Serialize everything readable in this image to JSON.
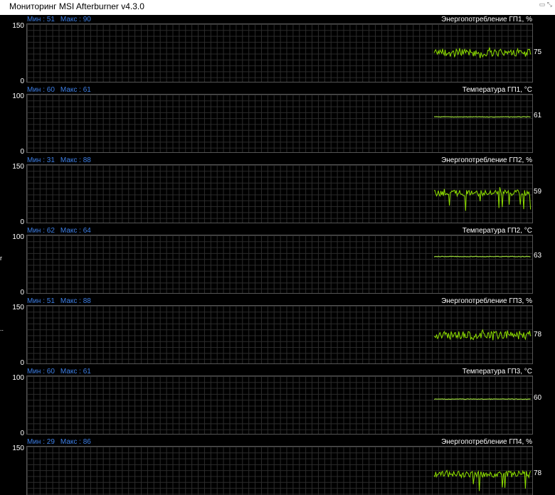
{
  "window": {
    "title": "Мониторинг MSI Afterburner v4.3.0",
    "icon": "window-controls-icon"
  },
  "panels": [
    {
      "min_label": "Мин : 51",
      "max_label": "Макс : 90",
      "title": "Энергопотребление ГП1, %",
      "ymax": "150",
      "ymin": "0",
      "current": "75",
      "value": 75,
      "vmax": 150,
      "trace": "noisy"
    },
    {
      "min_label": "Мин : 60",
      "max_label": "Макс : 61",
      "title": "Температура ГП1, °C",
      "ymax": "100",
      "ymin": "0",
      "current": "61",
      "value": 61,
      "vmax": 100,
      "trace": "flat"
    },
    {
      "min_label": "Мин : 31",
      "max_label": "Макс : 88",
      "title": "Энергопотребление ГП2, %",
      "ymax": "150",
      "ymin": "0",
      "current": "59",
      "value": 77,
      "vmax": 150,
      "trace": "spiky"
    },
    {
      "min_label": "Мин : 62",
      "max_label": "Макс : 64",
      "title": "Температура ГП2, °C",
      "ymax": "100",
      "ymin": "0",
      "current": "63",
      "value": 63,
      "vmax": 100,
      "trace": "flat"
    },
    {
      "min_label": "Мин : 51",
      "max_label": "Макс : 88",
      "title": "Энергопотребление ГП3, %",
      "ymax": "150",
      "ymin": "0",
      "current": "78",
      "value": 73,
      "vmax": 150,
      "trace": "noisy"
    },
    {
      "min_label": "Мин : 60",
      "max_label": "Макс : 61",
      "title": "Температура ГП3, °C",
      "ymax": "100",
      "ymin": "0",
      "current": "60",
      "value": 60,
      "vmax": 100,
      "trace": "flat"
    },
    {
      "min_label": "Мин : 29",
      "max_label": "Макс : 86",
      "title": "Энергопотребление ГП4, %",
      "ymax": "150",
      "ymin": "",
      "current": "78",
      "value": 78,
      "vmax": 150,
      "trace": "spiky"
    }
  ],
  "side_glyphs": [
    {
      "text": "r",
      "panel": 3
    },
    {
      "text": "..",
      "panel": 4
    }
  ],
  "colors": {
    "trace": "#8fe000",
    "flat_trace": "#9ad83a",
    "label_blue": "#3d7fe6",
    "grid": "#2c2c2c"
  }
}
